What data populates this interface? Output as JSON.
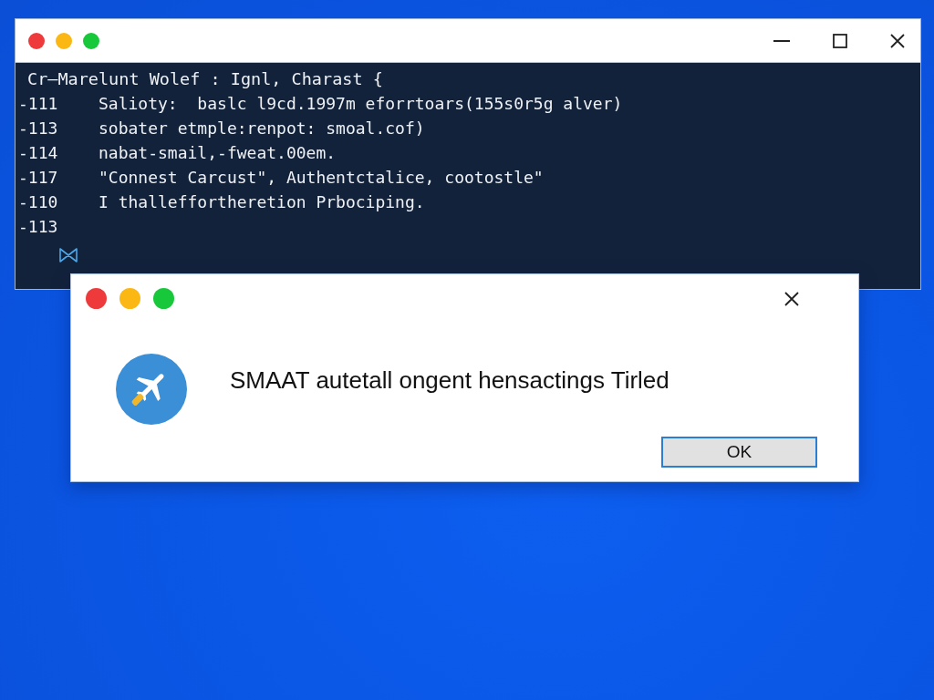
{
  "terminal": {
    "header": "Cr—Marelunt Wolef : Ignl, Charast {",
    "lines": [
      {
        "number": "-111",
        "code": "Salioty:  baslc l9cd.1997m eforrtoars(155s0r5g alver)"
      },
      {
        "number": "-113",
        "code": "sobater etmple:renpot: smoal.cof)"
      },
      {
        "number": "-114",
        "code": "nabat-smail,-fweat.00em."
      },
      {
        "number": "-117",
        "code": "\"Connest Carcust\", Authentctalice, cootostle\""
      },
      {
        "number": "-110",
        "code": "I thalleffortheretion Prbociping."
      },
      {
        "number": "-113"
      }
    ]
  },
  "dialog": {
    "message": "SMAAT autetall ongent hensactings Tirled",
    "buttons": [
      "OK"
    ]
  }
}
